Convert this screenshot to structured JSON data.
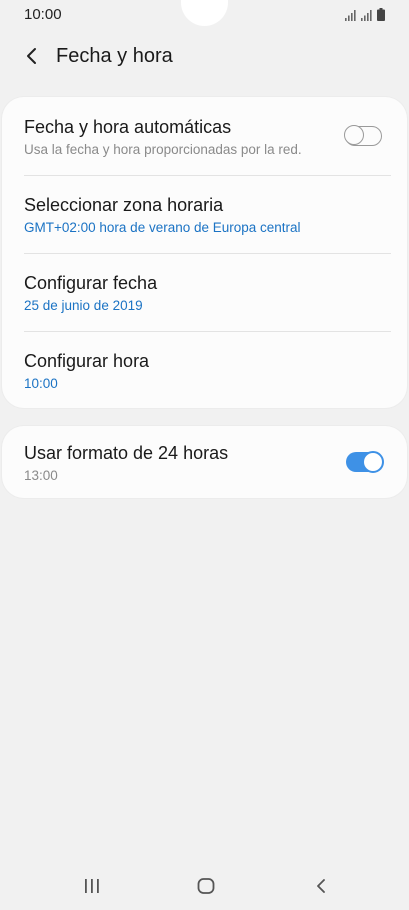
{
  "status_bar": {
    "time": "10:00",
    "icons": [
      "signal-icon",
      "signal-icon",
      "battery-icon"
    ]
  },
  "header": {
    "title": "Fecha y hora",
    "back_icon": "chevron-left-icon"
  },
  "settings_group_1": [
    {
      "title": "Fecha y hora automáticas",
      "subtitle": "Usa la fecha y hora proporcionadas por la red.",
      "toggle": false
    },
    {
      "title": "Seleccionar zona horaria",
      "subtitle": "GMT+02:00 hora de verano de Europa central"
    },
    {
      "title": "Configurar fecha",
      "subtitle": "25 de junio de 2019"
    },
    {
      "title": "Configurar hora",
      "subtitle": "10:00"
    }
  ],
  "settings_group_2": [
    {
      "title": "Usar formato de 24 horas",
      "subtitle": "13:00",
      "toggle": true
    }
  ],
  "navigation_bar": {
    "buttons": [
      "recent-apps-icon",
      "home-icon",
      "back-icon"
    ]
  },
  "colors": {
    "accent": "#3e91e6",
    "link_text": "#1b73c4",
    "background": "#f1f1f1",
    "card": "#fcfcfc"
  }
}
